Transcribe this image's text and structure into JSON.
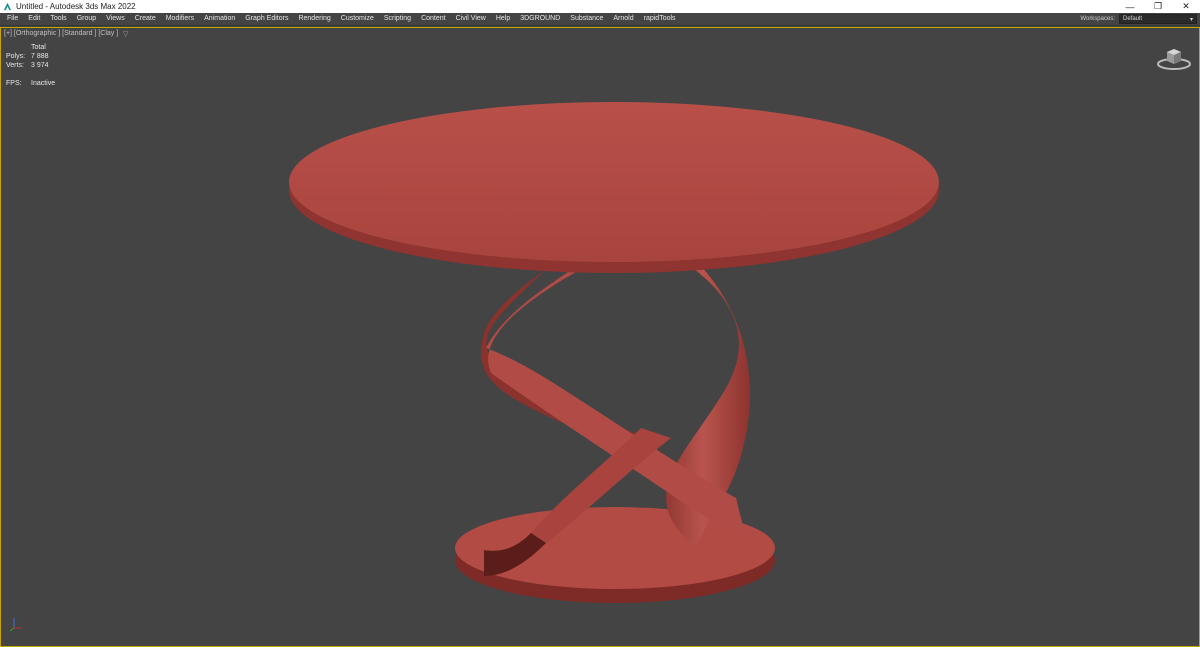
{
  "window": {
    "title": "Untitled - Autodesk 3ds Max 2022"
  },
  "menu": {
    "items": [
      "File",
      "Edit",
      "Tools",
      "Group",
      "Views",
      "Create",
      "Modifiers",
      "Animation",
      "Graph Editors",
      "Rendering",
      "Customize",
      "Scripting",
      "Content",
      "Civil View",
      "Help",
      "3DGROUND",
      "Substance",
      "Arnold",
      "rapidTools"
    ],
    "workspaces_label": "Workspaces:",
    "workspaces_value": "Default"
  },
  "viewport": {
    "label": "[+] [Orthographic ] [Standard ] [Clay ]",
    "stats": {
      "header": "Total",
      "polys_label": "Polys:",
      "polys_value": "7 888",
      "verts_label": "Verts:",
      "verts_value": "3 974",
      "fps_label": "FPS:",
      "fps_value": "Inactive"
    },
    "model_color": "#b04a45",
    "background_color": "#444444",
    "active_border_color": "#c8a400"
  },
  "icons": [
    "app-icon",
    "minimize-icon",
    "maximize-icon",
    "close-icon",
    "chevron-down-icon",
    "filter-icon",
    "viewcube-icon",
    "axis-tripod-icon"
  ]
}
